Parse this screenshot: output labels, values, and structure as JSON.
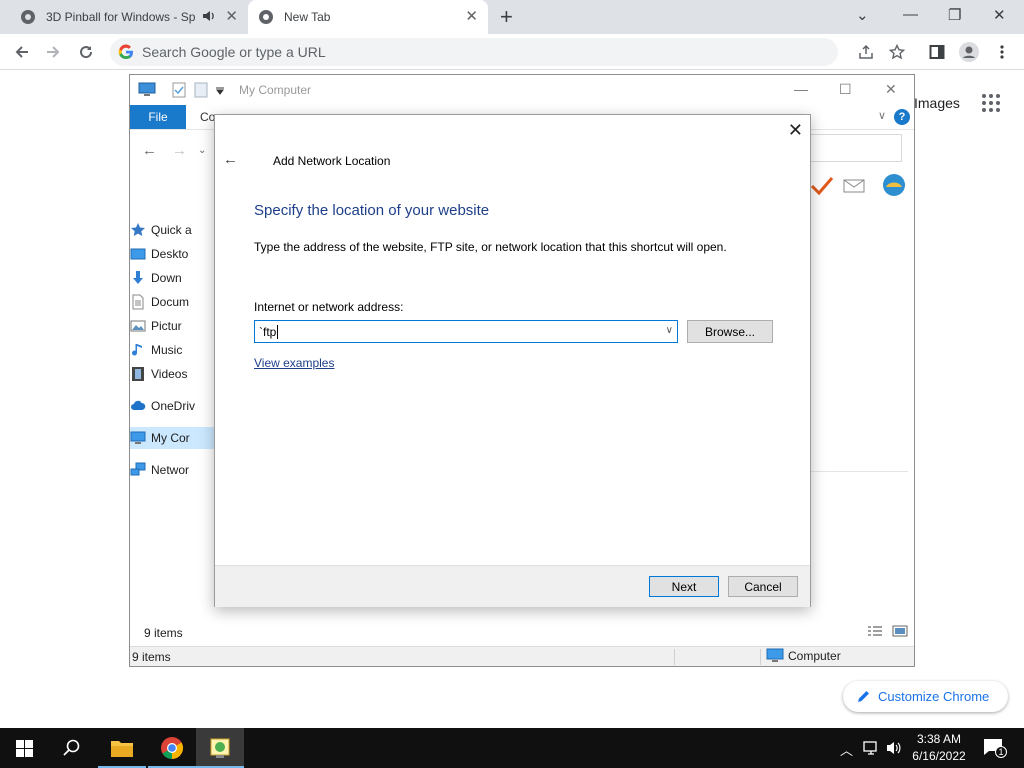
{
  "browser": {
    "tabs": [
      {
        "title": "3D Pinball for Windows - Sp"
      },
      {
        "title": "New Tab"
      }
    ],
    "new_tab_symbol": "+",
    "omnibox_placeholder": "Search Google or type a URL",
    "images_link": "Images",
    "customize_label": "Customize Chrome"
  },
  "explorer": {
    "title": "My Computer",
    "ribbon": {
      "file_tab": "File",
      "other_tab_fragment": "Co"
    },
    "help_symbol": "?",
    "nav_items": [
      {
        "label": "Quick a",
        "icon": "star-icon"
      },
      {
        "label": "Deskto",
        "icon": "desktop-icon"
      },
      {
        "label": "Down",
        "icon": "download-icon"
      },
      {
        "label": "Docum",
        "icon": "document-icon"
      },
      {
        "label": "Pictur",
        "icon": "picture-icon"
      },
      {
        "label": "Music",
        "icon": "music-icon"
      },
      {
        "label": "Videos",
        "icon": "video-icon"
      },
      {
        "label": "OneDriv",
        "icon": "cloud-icon"
      },
      {
        "label": "My Cor",
        "icon": "computer-icon",
        "selected": true
      },
      {
        "label": "Networ",
        "icon": "network-icon"
      }
    ],
    "item_count": "9 items",
    "statusbar": {
      "left": "9 items",
      "right": "Computer"
    }
  },
  "dialog": {
    "caption": "Add Network Location",
    "heading": "Specify the location of your website",
    "description": "Type the address of the website, FTP site, or network location that this shortcut will open.",
    "address_label": "Internet or network address:",
    "address_value": "`ftp",
    "browse_button": "Browse...",
    "examples_link": "View examples",
    "next_button": "Next",
    "cancel_button": "Cancel"
  },
  "taskbar": {
    "clock_time": "3:38 AM",
    "clock_date": "6/16/2022",
    "notification_count": "1"
  },
  "colors": {
    "accent_blue": "#0078d7",
    "file_tab_blue": "#1979ca",
    "heading_blue": "#1e3f8a",
    "chrome_link": "#1a73e8"
  }
}
